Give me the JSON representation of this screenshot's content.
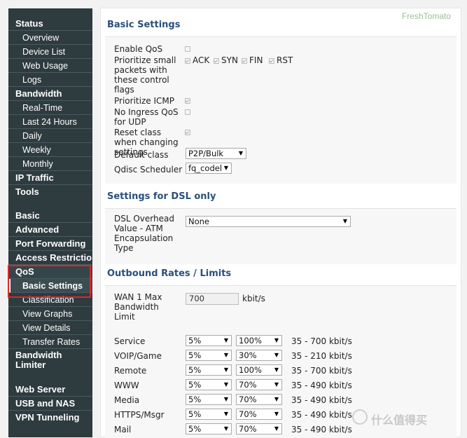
{
  "sidebar": {
    "items": [
      {
        "label": "Status",
        "type": "section"
      },
      {
        "label": "Overview",
        "type": "sub"
      },
      {
        "label": "Device List",
        "type": "sub"
      },
      {
        "label": "Web Usage",
        "type": "sub"
      },
      {
        "label": "Logs",
        "type": "sub"
      },
      {
        "label": "Bandwidth",
        "type": "section"
      },
      {
        "label": "Real-Time",
        "type": "sub"
      },
      {
        "label": "Last 24 Hours",
        "type": "sub"
      },
      {
        "label": "Daily",
        "type": "sub"
      },
      {
        "label": "Weekly",
        "type": "sub"
      },
      {
        "label": "Monthly",
        "type": "sub"
      },
      {
        "label": "IP Traffic",
        "type": "section"
      },
      {
        "label": "Tools",
        "type": "section"
      },
      {
        "label": "Basic",
        "type": "section"
      },
      {
        "label": "Advanced",
        "type": "section"
      },
      {
        "label": "Port Forwarding",
        "type": "section"
      },
      {
        "label": "Access Restriction",
        "type": "section"
      },
      {
        "label": "QoS",
        "type": "section"
      },
      {
        "label": "Basic Settings",
        "type": "sub",
        "active": true
      },
      {
        "label": "Classification",
        "type": "sub"
      },
      {
        "label": "View Graphs",
        "type": "sub"
      },
      {
        "label": "View Details",
        "type": "sub"
      },
      {
        "label": "Transfer Rates",
        "type": "sub"
      },
      {
        "label": "Bandwidth Limiter",
        "type": "section"
      },
      {
        "label": "Web Server",
        "type": "section"
      },
      {
        "label": "USB and NAS",
        "type": "section"
      },
      {
        "label": "VPN Tunneling",
        "type": "section"
      }
    ]
  },
  "brand": "FreshTomato",
  "basic": {
    "title": "Basic Settings",
    "enable_qos": "Enable QoS",
    "prioritize_small": "Prioritize small packets with these control flags",
    "flags": [
      "ACK",
      "SYN",
      "FIN",
      "RST"
    ],
    "prioritize_icmp": "Prioritize ICMP",
    "no_ingress": "No Ingress QoS for UDP",
    "reset_class": "Reset class when changing settings",
    "default_class_label": "Default class",
    "default_class_value": "P2P/Bulk",
    "qdisc_label": "Qdisc Scheduler",
    "qdisc_value": "fq_codel"
  },
  "dsl": {
    "title": "Settings for DSL only",
    "overhead_label": "DSL Overhead Value - ATM Encapsulation Type",
    "overhead_value": "None"
  },
  "outbound": {
    "title": "Outbound Rates / Limits",
    "wan_label": "WAN 1 Max Bandwidth Limit",
    "wan_value": "700",
    "wan_unit": "kbit/s",
    "rows": [
      {
        "name": "Service",
        "min": "5%",
        "max": "100%",
        "range": "35 - 700 kbit/s"
      },
      {
        "name": "VOIP/Game",
        "min": "5%",
        "max": "30%",
        "range": "35 - 210 kbit/s"
      },
      {
        "name": "Remote",
        "min": "5%",
        "max": "100%",
        "range": "35 - 700 kbit/s"
      },
      {
        "name": "WWW",
        "min": "5%",
        "max": "70%",
        "range": "35 - 490 kbit/s"
      },
      {
        "name": "Media",
        "min": "5%",
        "max": "70%",
        "range": "35 - 490 kbit/s"
      },
      {
        "name": "HTTPS/Msgr",
        "min": "5%",
        "max": "70%",
        "range": "35 - 490 kbit/s"
      },
      {
        "name": "Mail",
        "min": "5%",
        "max": "70%",
        "range": "35 - 490 kbit/s"
      }
    ]
  },
  "watermark": "什么值得买"
}
